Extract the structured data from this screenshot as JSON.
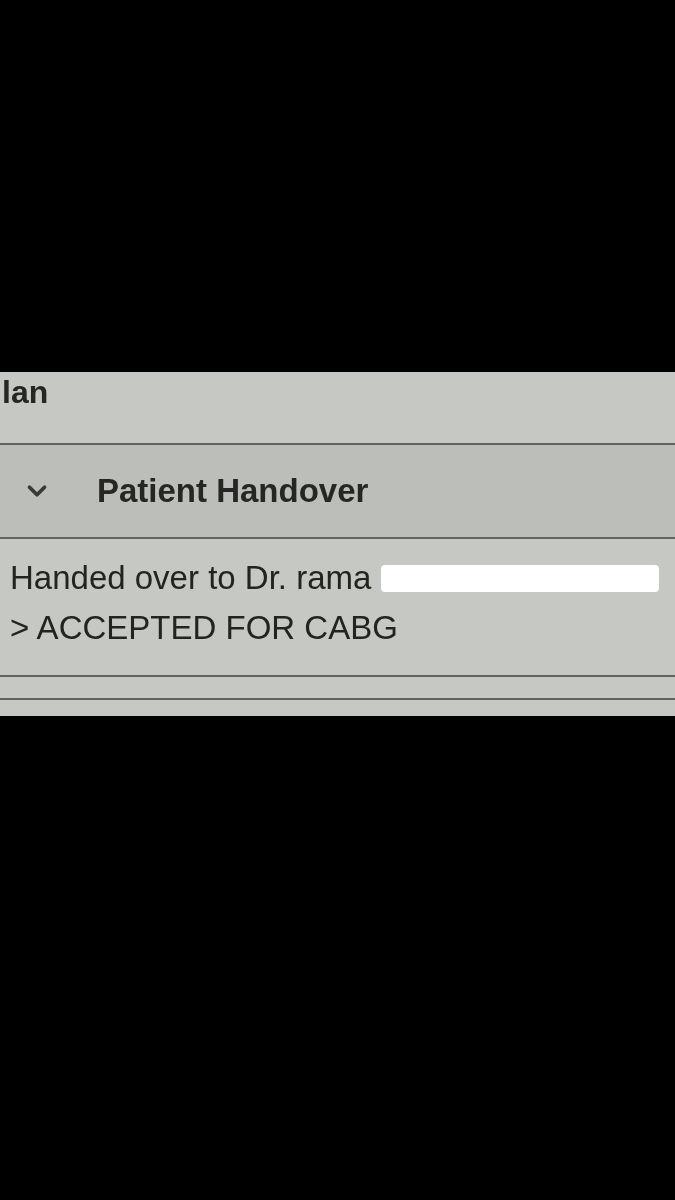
{
  "previous_section": {
    "title": "lan"
  },
  "sections": [
    {
      "title": "Patient Handover",
      "expanded": true,
      "lines": [
        {
          "text": "Handed over to Dr. rama",
          "redacted": true
        },
        {
          "text": "> ACCEPTED FOR CABG",
          "redacted": false
        }
      ]
    }
  ]
}
